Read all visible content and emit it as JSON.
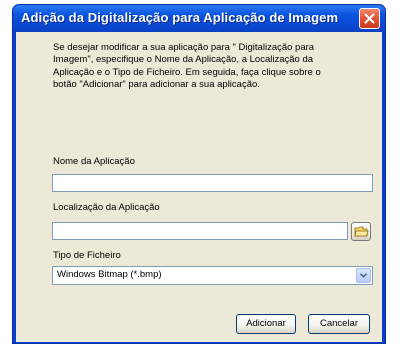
{
  "dialog": {
    "title": "Adição da Digitalização para Aplicação de Imagem",
    "intro_lines": [
      "Se desejar modificar a sua aplicação para \" Digitalização para",
      "Imagem\", especifique o Nome da Aplicação, a Localização da",
      "Aplicação e o Tipo de Ficheiro. Em seguida, faça clique sobre o",
      "botão  \"Adicionar\" para adicionar a sua aplicação."
    ]
  },
  "fields": {
    "app_name": {
      "label": "Nome da Aplicação",
      "value": ""
    },
    "app_location": {
      "label": "Localização da Aplicação",
      "value": ""
    },
    "file_type": {
      "label": "Tipo de Ficheiro",
      "value": "Windows Bitmap (*.bmp)"
    }
  },
  "buttons": {
    "add": "Adicionar",
    "cancel": "Cancelar"
  },
  "icons": {
    "close": "close-icon",
    "browse": "folder-icon",
    "dropdown": "chevron-down-icon"
  },
  "colors": {
    "titlebar": "#0a55e0",
    "close_button": "#e2553a",
    "dialog_background": "#ece9d8",
    "input_border": "#7f9db9"
  }
}
